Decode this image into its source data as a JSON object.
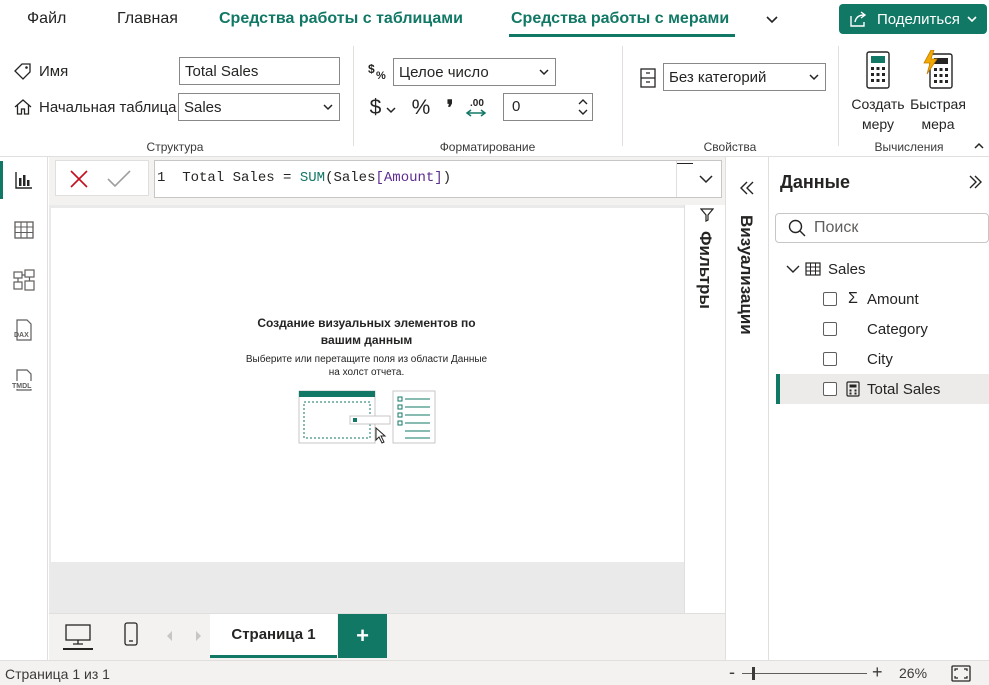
{
  "tabs": {
    "file": "Файл",
    "home": "Главная",
    "table_tools": "Средства работы с таблицами",
    "measure_tools": "Средства работы с мерами",
    "share": "Поделиться"
  },
  "ribbon": {
    "structure": {
      "name_label": "Имя",
      "name_value": "Total Sales",
      "home_table_label": "Начальная таблица",
      "home_table_value": "Sales",
      "group_label": "Структура"
    },
    "formatting": {
      "format_value": "Целое число",
      "currency_symbol": "$",
      "percent_symbol": "%",
      "comma_symbol": "❜",
      "decimal_places": "0",
      "group_label": "Форматирование"
    },
    "properties": {
      "category_value": "Без категорий",
      "group_label": "Свойства"
    },
    "calculations": {
      "new_measure_line1": "Создать",
      "new_measure_line2": "меру",
      "quick_measure_line1": "Быстрая",
      "quick_measure_line2": "мера",
      "group_label": "Вычисления"
    }
  },
  "formula": {
    "line_number": "1",
    "text_pre": "Total Sales = ",
    "function": "SUM",
    "open": "(",
    "table": "Sales",
    "column": "[Amount]",
    "close": ")"
  },
  "canvas": {
    "hint_title": "Создание визуальных элементов по вашим данным",
    "hint_sub_pre": "Выберите или перетащите поля из области ",
    "hint_sub_bold": "Данные",
    "hint_sub_post": " на холст отчета."
  },
  "panes": {
    "filters": "Фильтры",
    "visualizations": "Визуализации",
    "data_title": "Данные",
    "search_placeholder": "Поиск"
  },
  "data_tree": {
    "table": "Sales",
    "fields": [
      {
        "name": "Amount",
        "icon": "sigma-icon"
      },
      {
        "name": "Category",
        "icon": ""
      },
      {
        "name": "City",
        "icon": ""
      },
      {
        "name": "Total Sales",
        "icon": "calculator-icon"
      }
    ]
  },
  "pages": {
    "page_tab": "Страница 1",
    "add": "+"
  },
  "status": {
    "page_info": "Страница 1 из 1",
    "zoom": "26%",
    "zoom_fraction": 0.08
  },
  "colors": {
    "accent": "#117865",
    "column": "#5c2e91"
  }
}
